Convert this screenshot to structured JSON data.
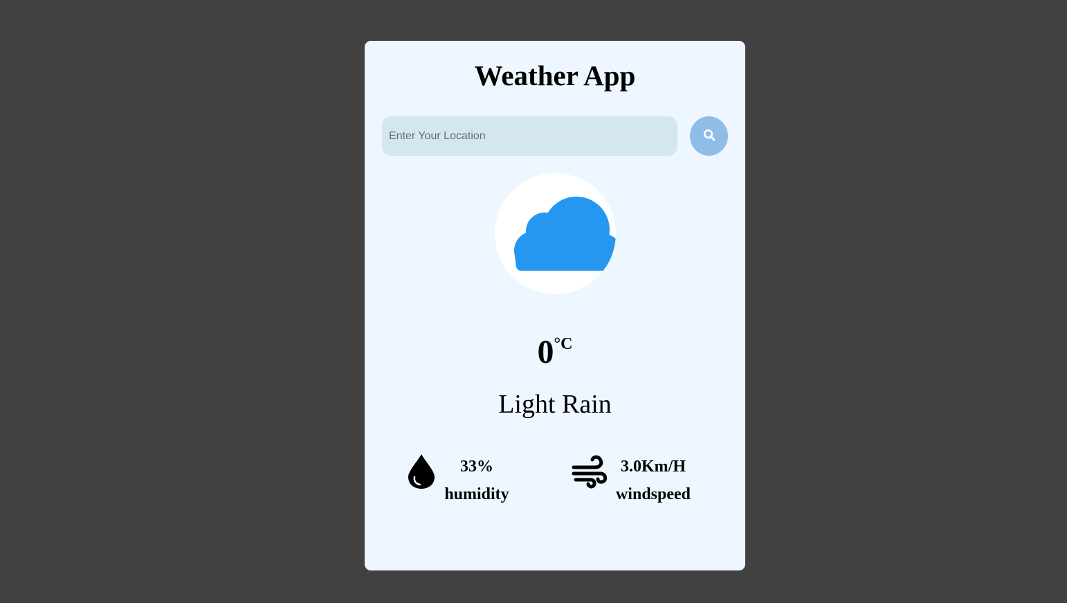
{
  "app": {
    "title": "Weather App"
  },
  "search": {
    "placeholder": "Enter Your Location",
    "value": "",
    "icon": "search-icon"
  },
  "weather": {
    "icon": "cloud-icon",
    "temperature": "0",
    "unit": "°C",
    "description": "Light Rain"
  },
  "stats": {
    "humidity": {
      "value": "33%",
      "label": "humidity",
      "icon": "water-drop-icon"
    },
    "wind": {
      "value": "3.0Km/H",
      "label": "windspeed",
      "icon": "wind-icon"
    }
  },
  "colors": {
    "page_background": "#414141",
    "card_background": "#eef7ff",
    "input_background": "#d4e7f1",
    "button_background": "#8ebde8",
    "cloud": "#2697f0"
  }
}
